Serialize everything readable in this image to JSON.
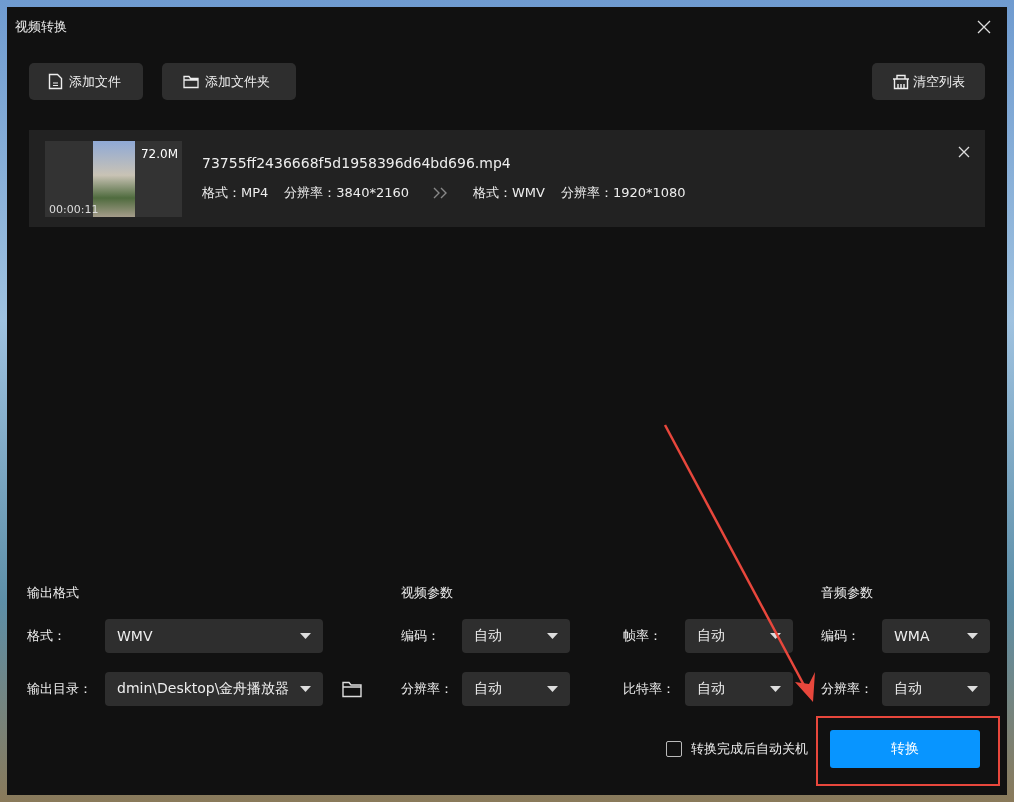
{
  "window": {
    "title": "视频转换"
  },
  "toolbar": {
    "buttons": [
      {
        "kind": "file",
        "label": "添加文件"
      },
      {
        "kind": "folder",
        "label": "添加文件夹"
      }
    ],
    "clear_button": {
      "label": "清空列表"
    }
  },
  "files": [
    {
      "name": "73755ff2436668f5d1958396d64bd696.mp4",
      "size": "72.0M",
      "duration": "00:00:11",
      "source": {
        "format_label": "格式：",
        "format": "MP4",
        "resolution_label": "分辨率：",
        "resolution": "3840*2160"
      },
      "target": {
        "format_label": "格式：",
        "format": "WMV",
        "resolution_label": "分辨率：",
        "resolution": "1920*1080"
      }
    }
  ],
  "output": {
    "title": "输出格式",
    "fields": [
      {
        "label": "格式：",
        "value": "WMV",
        "kind": "select"
      },
      {
        "label": "输出目录：",
        "value": "dmin\\Desktop\\金舟播放器",
        "kind": "folder"
      }
    ]
  },
  "video": {
    "title": "视频参数",
    "fields": [
      {
        "label": "编码：",
        "value": "自动"
      },
      {
        "label": "帧率：",
        "value": "自动"
      },
      {
        "label": "分辨率：",
        "value": "自动"
      },
      {
        "label": "比特率：",
        "value": "自动"
      }
    ]
  },
  "audio": {
    "title": "音频参数",
    "fields": [
      {
        "label": "编码：",
        "value": "WMA"
      },
      {
        "label": "分辨率：",
        "value": "自动"
      }
    ]
  },
  "shutdown": {
    "label": "转换完成后自动关机",
    "checked": false
  },
  "convert_button": {
    "label": "转换"
  }
}
